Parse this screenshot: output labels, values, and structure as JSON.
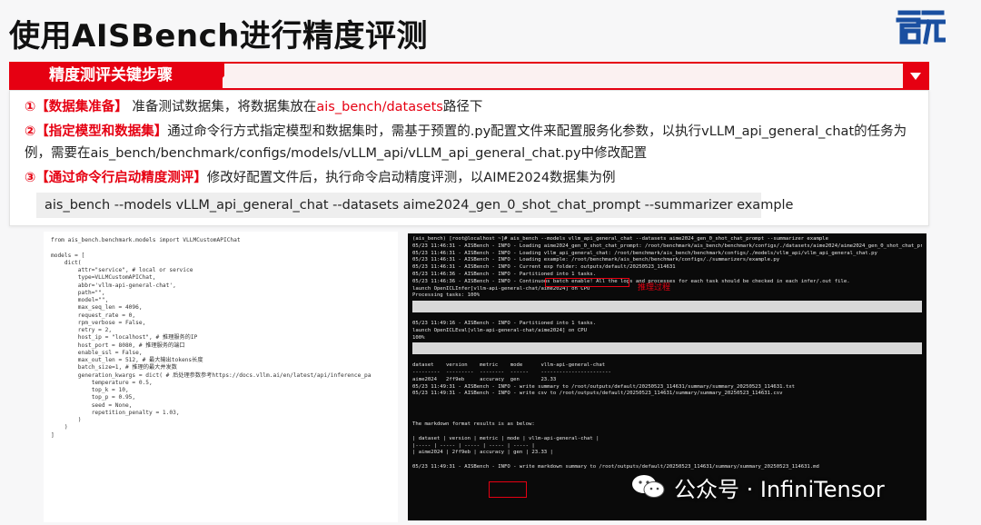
{
  "slide": {
    "title": "使用AISBench进行精度评测",
    "logo_text": "启元"
  },
  "section": {
    "title": "精度测评关键步骤"
  },
  "steps": [
    {
      "num": "①",
      "label": "【数据集准备】",
      "text_before": "准备测试数据集，将数据集放在",
      "path": "ais_bench/datasets",
      "text_after": "路径下"
    },
    {
      "num": "②",
      "label": "【指定模型和数据集】",
      "text": "通过命令行方式指定模型和数据集时，需基于预置的.py配置文件来配置服务化参数，以执行vLLM_api_general_chat的任务为例，需要在ais_bench/benchmark/configs/models/vLLM_api/vLLM_api_general_chat.py中修改配置"
    },
    {
      "num": "③",
      "label": "【通过命令行启动精度测评】",
      "text": "修改好配置文件后，执行命令启动精度评测，以AIME2024数据集为例"
    }
  ],
  "command": "ais_bench --models vLLM_api_general_chat --datasets aime2024_gen_0_shot_chat_prompt --summarizer example",
  "code_lines": [
    "from ais_bench.benchmark.models import VLLMCustomAPIChat",
    "",
    "models = [",
    "    dict(",
    "        attr=\"service\", # local or service",
    "        type=VLLMCustomAPIChat,",
    "        abbr='vllm-api-general-chat',",
    "        path=\"\",",
    "        model=\"\",",
    "        max_seq_len = 4096,",
    "        request_rate = 0,",
    "        rpm_verbose = False,",
    "        retry = 2,",
    "        host_ip = \"localhost\", # 推理服务的IP",
    "        host_port = 8080, # 推理服务的端口",
    "        enable_ssl = False,",
    "        max_out_len = 512, # 最大输出tokens长度",
    "        batch_size=1, # 推理的最大并发数",
    "        generation_kwargs = dict( # 后处理参数参考https://docs.vllm.ai/en/latest/api/inference_pa",
    "            temperature = 0.5,",
    "            top_k = 10,",
    "            top_p = 0.95,",
    "            seed = None,",
    "            repetition_penalty = 1.03,",
    "        )",
    "    )",
    "]"
  ],
  "terminal": {
    "lines_a": [
      "(ais_bench) [root@localhost ~]# ais_bench --models vllm_api_general_chat --datasets aime2024_gen_0_shot_chat_prompt --summarizer example",
      "05/23 11:46:31 - AISBench - INFO - Loading aime2024_gen_0_shot_chat_prompt: /root/benchmark/ais_bench/benchmark/configs/./datasets/aime2024/aime2024_gen_0_shot_chat_prompt.py",
      "05/23 11:46:31 - AISBench - INFO - Loading vllm_api_general_chat: /root/benchmark/ais_bench/benchmark/configs/./models/vllm_api/vllm_api_general_chat.py",
      "05/23 11:46:31 - AISBench - INFO - Loading example: /root/benchmark/ais_bench/benchmark/configs/./summarizers/example.py",
      "05/23 11:46:31 - AISBench - INFO - Current exp folder: outputs/default/20250523_114631",
      "05/23 11:46:36 - AISBench - INFO - Partitioned into 1 tasks.",
      "05/23 11:46:36 - AISBench - INFO - Continuous batch enable! All the logs and processes for each task should be checked in each infer/.out file.",
      "launch OpenICLInfer[vllm-api-general-chat/aime2024] on CPU",
      "Processing tasks: 100%"
    ],
    "lines_b": [
      "05/23 11:49:16 - AISBench - INFO - Partitioned into 1 tasks.",
      "launch OpenICLEval[vllm-api-general-chat/aime2024] on CPU",
      "100%"
    ],
    "lines_c": [
      "dataset    version    metric    mode      vllm-api-general-chat",
      "---------  ---------  --------  ------    -----------------------",
      "aime2024   2ff9eb     accuracy  gen       23.33",
      "05/23 11:49:31 - AISBench - INFO - write summary to /root/outputs/default/20250523_114631/summary/summary_20250523_114631.txt",
      "05/23 11:49:31 - AISBench - INFO - write csv to /root/outputs/default/20250523_114631/summary/summary_20250523_114631.csv"
    ],
    "lines_d": [
      "The markdown format results is as below:",
      "",
      "| dataset | version | metric | mode | vllm-api-general-chat |",
      "|----- | ----- | ----- | ----- | ----- |",
      "| aime2024 | 2ff9eb | accuracy | gen | 23.33 |",
      "",
      "05/23 11:49:31 - AISBench - INFO - write markdown summary to /root/outputs/default/20250523_114631/summary/summary_20250523_114631.md"
    ],
    "note": "推理过程"
  },
  "watermark": "公众号 · InfiniTensor",
  "colors": {
    "accent": "#e60012",
    "logo": "#1a4fa0"
  }
}
